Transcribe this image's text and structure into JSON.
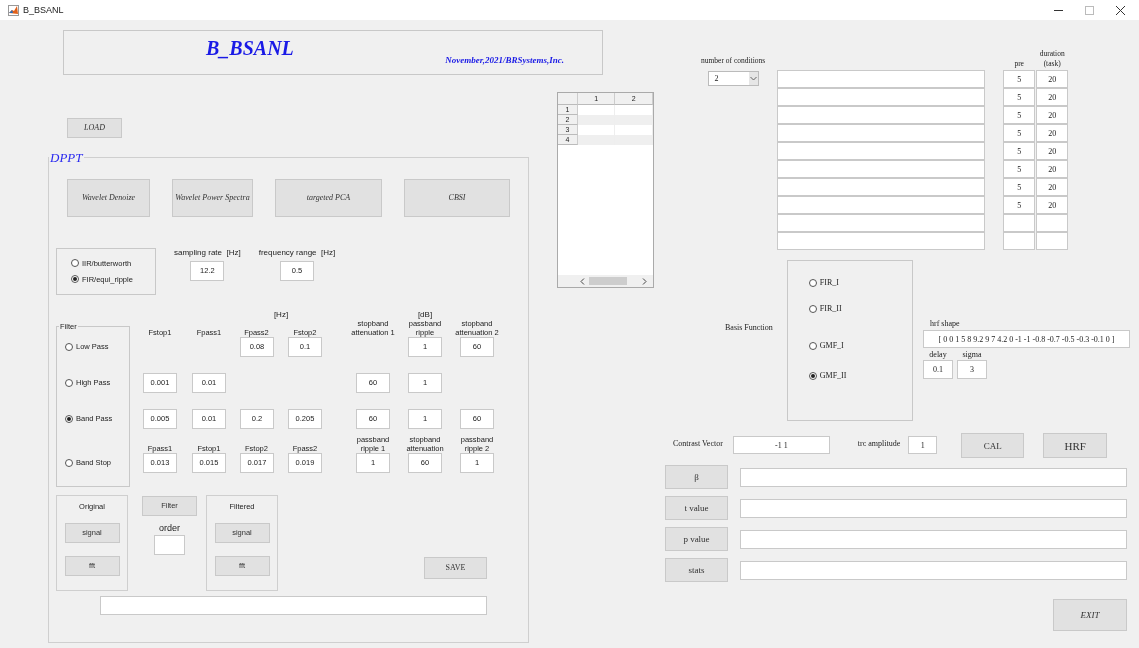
{
  "window": {
    "title": "B_BSANL"
  },
  "header": {
    "title": "B_BSANL",
    "subtitle": "November,2021/BRSystems,Inc."
  },
  "load_button": "LOAD",
  "dppt": {
    "legend": "DPPT",
    "tools": [
      "Wavelet Denoize",
      "Wavelet Power Spectra",
      "targeted PCA",
      "CBSI"
    ],
    "filter_types": [
      {
        "label": "IIR/butterworth",
        "selected": false
      },
      {
        "label": "FIR/equi_ripple",
        "selected": true
      }
    ],
    "sampling_rate": {
      "label": "sampling rate",
      "unit": "[Hz]",
      "value": "12.2"
    },
    "frequency_range": {
      "label": "frequency range",
      "unit": "[Hz]",
      "value": "0.5"
    },
    "filter": {
      "legend": "Filter",
      "hz_unit": "[Hz]",
      "db_unit": "[dB]",
      "rows": [
        {
          "label": "Low Pass",
          "selected": false,
          "headers": [
            "Fstop1",
            "Fpass1",
            "Fpass2",
            "Fstop2",
            "stopband attenuation 1",
            "passband ripple",
            "stopband attenuation 2"
          ],
          "values": {
            "column_3": "0.08",
            "column_4": "0.1",
            "column_6": "1",
            "column_7": "60"
          }
        },
        {
          "label": "High Pass",
          "selected": false,
          "values": {
            "column_1": "0.001",
            "column_2": "0.01",
            "column_5": "60",
            "column_6": "1"
          }
        },
        {
          "label": "Band Pass",
          "selected": true,
          "values": {
            "column_1": "0.005",
            "column_2": "0.01",
            "column_3": "0.2",
            "column_4": "0.205",
            "column_5": "60",
            "column_6": "1",
            "column_7": "60"
          }
        },
        {
          "label": "Band Stop",
          "selected": false,
          "headers": [
            "Fpass1",
            "Fstop1",
            "Fstop2",
            "Fpass2",
            "passband ripple 1",
            "stopband attenuation",
            "passband ripple 2"
          ],
          "values": {
            "column_1": "0.013",
            "column_2": "0.015",
            "column_3": "0.017",
            "column_4": "0.019",
            "column_5": "1",
            "column_6": "60",
            "column_7": "1"
          }
        }
      ]
    },
    "original": {
      "title": "Original",
      "buttons": [
        "signal",
        "fft"
      ]
    },
    "filter_button": "Filter",
    "order": {
      "label": "order"
    },
    "filtered": {
      "title": "Filtered",
      "buttons": [
        "signal",
        "fft"
      ]
    },
    "save_button": "SAVE"
  },
  "table": {
    "columns": [
      "1",
      "2"
    ],
    "rows": [
      "1",
      "2",
      "3",
      "4"
    ]
  },
  "conditions": {
    "label": "number of conditions",
    "value": "2",
    "pre_header": "pre",
    "duration_header": "duration (task)",
    "rows": [
      {
        "pre": "5",
        "duration": "20"
      },
      {
        "pre": "5",
        "duration": "20"
      },
      {
        "pre": "5",
        "duration": "20"
      },
      {
        "pre": "5",
        "duration": "20"
      },
      {
        "pre": "5",
        "duration": "20"
      },
      {
        "pre": "5",
        "duration": "20"
      },
      {
        "pre": "5",
        "duration": "20"
      },
      {
        "pre": "5",
        "duration": "20"
      },
      {
        "pre": null,
        "duration": null
      },
      {
        "pre": null,
        "duration": null
      }
    ]
  },
  "basis_function": {
    "label": "Basis Function",
    "options": [
      {
        "label": "FIR_I",
        "selected": false
      },
      {
        "label": "FIR_II",
        "selected": false
      },
      {
        "label": "GMF_I",
        "selected": false
      },
      {
        "label": "GMF_II",
        "selected": true
      }
    ]
  },
  "hrf": {
    "shape_label": "hrf shape",
    "shape": "[ 0 0 1 5 8 9.2 9 7 4.2 0 -1 -1 -0.8 -0.7 -0.5 -0.3 -0.1 0 ]",
    "delay_label": "delay",
    "delay": "0.1",
    "sigma_label": "sigma",
    "sigma": "3"
  },
  "contrast": {
    "label": "Contrast Vector",
    "value": "-1 1",
    "trc_label": "trc amplitude",
    "trc_value": "1",
    "cal_button": "CAL",
    "hrf_button": "HRF"
  },
  "results": [
    {
      "button": "β"
    },
    {
      "button": "t value"
    },
    {
      "button": "p value"
    },
    {
      "button": "stats"
    }
  ],
  "exit_button": "EXIT"
}
